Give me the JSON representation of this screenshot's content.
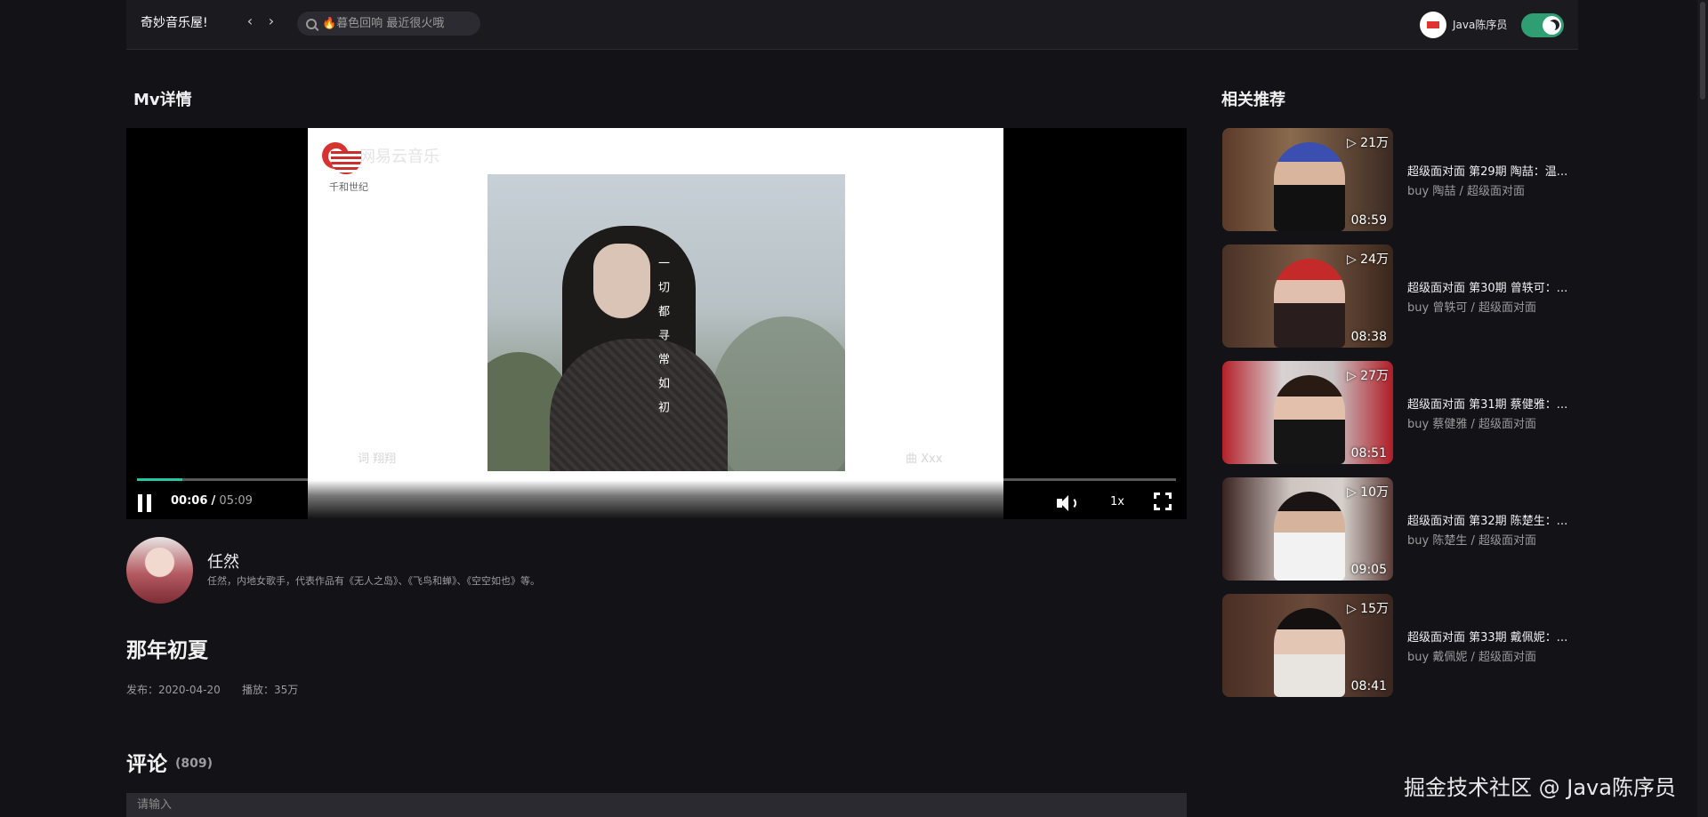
{
  "header": {
    "brand": "奇妙音乐屋!",
    "back_icon": "chevron-left-icon",
    "forward_icon": "chevron-right-icon",
    "search_placeholder": "🔥暮色回响 最近很火哦",
    "user_name": "Java陈序员",
    "theme_toggle": "dark"
  },
  "mv_section_title": "Mv详情",
  "related_section_title": "相关推荐",
  "player": {
    "brand_text": "千和世纪",
    "faint_text": "网易云音乐",
    "vertical_text": "一切都寻常如初",
    "credit_left": "词  翔翔",
    "credit_right": "曲  Xxx",
    "current_time": "00:06",
    "separator": "/",
    "total_time": "05:09",
    "progress_percent": 2,
    "speed": "1x",
    "accent_color": "#27c6a3"
  },
  "artist": {
    "name": "任然",
    "description": "任然，内地女歌手，代表作品有《无人之岛》、《飞鸟和蝉》、《空空如也》等。"
  },
  "mv": {
    "title": "那年初夏",
    "publish": "发布：2020-04-20",
    "plays": "播放：35万"
  },
  "comments": {
    "title": "评论",
    "count": "(809)",
    "placeholder": "请输入"
  },
  "related": [
    {
      "plays": "▷ 21万",
      "duration": "08:59",
      "title": "超级面对面 第29期 陶喆：温...",
      "subtitle": "buy 陶喆 / 超级面对面"
    },
    {
      "plays": "▷ 24万",
      "duration": "08:38",
      "title": "超级面对面 第30期 曾轶可：...",
      "subtitle": "buy 曾轶可 / 超级面对面"
    },
    {
      "plays": "▷ 27万",
      "duration": "08:51",
      "title": "超级面对面 第31期 蔡健雅：...",
      "subtitle": "buy 蔡健雅 / 超级面对面"
    },
    {
      "plays": "▷ 10万",
      "duration": "09:05",
      "title": "超级面对面 第32期 陈楚生：...",
      "subtitle": "buy 陈楚生 / 超级面对面"
    },
    {
      "plays": "▷ 15万",
      "duration": "08:41",
      "title": "超级面对面 第33期 戴佩妮：...",
      "subtitle": "buy 戴佩妮 / 超级面对面"
    }
  ],
  "watermark": "掘金技术社区 @ Java陈序员"
}
